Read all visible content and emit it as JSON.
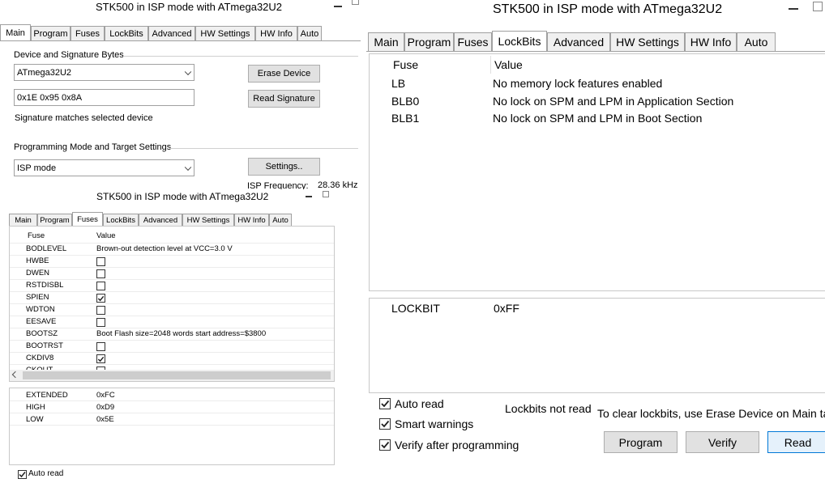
{
  "main_window": {
    "title": "STK500 in ISP mode with ATmega32U2",
    "tabs": [
      "Main",
      "Program",
      "Fuses",
      "LockBits",
      "Advanced",
      "HW Settings",
      "HW Info",
      "Auto"
    ],
    "active_tab": "Main",
    "device_group_label": "Device and Signature Bytes",
    "device_select": "ATmega32U2",
    "erase_button": "Erase Device",
    "signature_value": "0x1E 0x95 0x8A",
    "read_signature_button": "Read Signature",
    "signature_status": "Signature matches selected device",
    "prog_group_label": "Programming Mode and Target Settings",
    "mode_select": "ISP mode",
    "settings_button": "Settings..",
    "isp_freq_label": "ISP Frequency:",
    "isp_freq_value": "28.36 kHz"
  },
  "fuses_window": {
    "title": "STK500 in ISP mode with ATmega32U2",
    "tabs": [
      "Main",
      "Program",
      "Fuses",
      "LockBits",
      "Advanced",
      "HW Settings",
      "HW Info",
      "Auto"
    ],
    "active_tab": "Fuses",
    "col_fuse": "Fuse",
    "col_value": "Value",
    "rows": [
      {
        "name": "BODLEVEL",
        "text": "Brown-out detection level at VCC=3.0 V"
      },
      {
        "name": "HWBE",
        "checked": false
      },
      {
        "name": "DWEN",
        "checked": false
      },
      {
        "name": "RSTDISBL",
        "checked": false
      },
      {
        "name": "SPIEN",
        "checked": true
      },
      {
        "name": "WDTON",
        "checked": false
      },
      {
        "name": "EESAVE",
        "checked": false
      },
      {
        "name": "BOOTSZ",
        "text": "Boot Flash size=2048 words start address=$3800"
      },
      {
        "name": "BOOTRST",
        "checked": false
      },
      {
        "name": "CKDIV8",
        "checked": true
      },
      {
        "name": "CKOUT",
        "checked": false
      }
    ],
    "fuse_bytes": [
      {
        "name": "EXTENDED",
        "value": "0xFC"
      },
      {
        "name": "HIGH",
        "value": "0xD9"
      },
      {
        "name": "LOW",
        "value": "0x5E"
      }
    ],
    "auto_read_label": "Auto read",
    "auto_read_checked": true
  },
  "lockbits_window": {
    "title": "STK500 in ISP mode with ATmega32U2",
    "tabs": [
      "Main",
      "Program",
      "Fuses",
      "LockBits",
      "Advanced",
      "HW Settings",
      "HW Info",
      "Auto"
    ],
    "active_tab": "LockBits",
    "col_fuse": "Fuse",
    "col_value": "Value",
    "rows": [
      {
        "name": "LB",
        "value": "No memory lock features enabled"
      },
      {
        "name": "BLB0",
        "value": "No lock on SPM and LPM in Application Section"
      },
      {
        "name": "BLB1",
        "value": "No lock on SPM and LPM in Boot Section"
      }
    ],
    "lockbit_name": "LOCKBIT",
    "lockbit_value": "0xFF",
    "options": [
      {
        "label": "Auto read",
        "checked": true
      },
      {
        "label": "Smart warnings",
        "checked": true
      },
      {
        "label": "Verify after programming",
        "checked": true
      }
    ],
    "status_text": "Lockbits not read",
    "hint_text": "To clear lockbits, use Erase Device on Main tab",
    "program_button": "Program",
    "verify_button": "Verify",
    "read_button": "Read"
  }
}
